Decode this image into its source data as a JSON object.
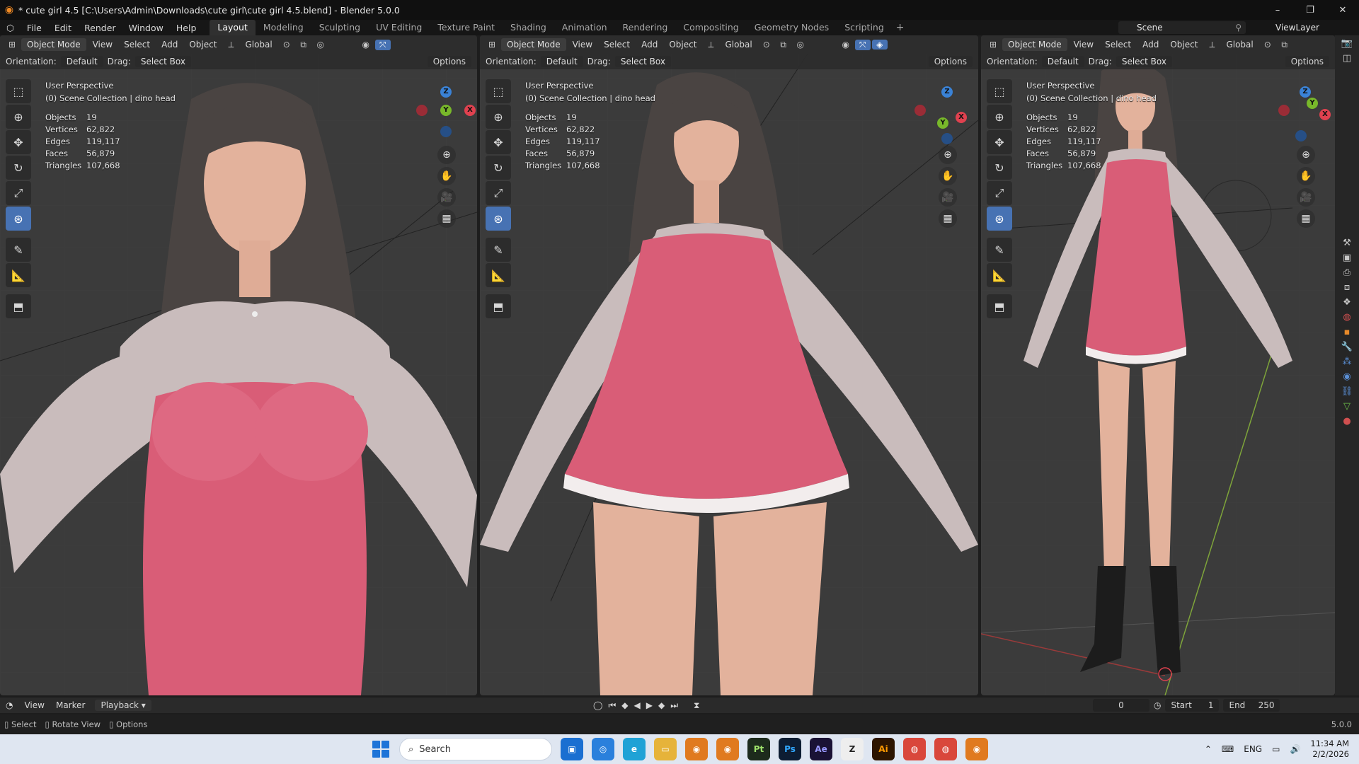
{
  "window": {
    "title": "* cute girl 4.5 [C:\\Users\\Admin\\Downloads\\cute girl\\cute girl 4.5.blend] - Blender 5.0.0",
    "controls": [
      "–",
      "❐",
      "✕"
    ]
  },
  "menubar": {
    "items": [
      "File",
      "Edit",
      "Render",
      "Window",
      "Help"
    ],
    "workspaces": [
      "Layout",
      "Modeling",
      "Sculpting",
      "UV Editing",
      "Texture Paint",
      "Shading",
      "Animation",
      "Rendering",
      "Compositing",
      "Geometry Nodes",
      "Scripting"
    ],
    "active_workspace": "Layout",
    "scene": "Scene",
    "view_layer": "ViewLayer"
  },
  "viewport_header": {
    "mode": "Object Mode",
    "menus": [
      "View",
      "Select",
      "Add",
      "Object"
    ],
    "transform": "Global",
    "orientation_label": "Orientation:",
    "orientation_value": "Default",
    "drag_label": "Drag:",
    "drag_value": "Select Box",
    "options": "Options"
  },
  "viewport_info": {
    "view_name": "User Perspective",
    "collection": "(0) Scene Collection | dino head",
    "stats": [
      {
        "label": "Objects",
        "value": "19"
      },
      {
        "label": "Vertices",
        "value": "62,822"
      },
      {
        "label": "Edges",
        "value": "119,117"
      },
      {
        "label": "Faces",
        "value": "56,879"
      },
      {
        "label": "Triangles",
        "value": "107,668"
      }
    ]
  },
  "gizmo": {
    "x": "X",
    "y": "Y",
    "z": "Z"
  },
  "colors": {
    "accent": "#4772b3",
    "dress": "#d95d77",
    "sleeve": "#c9bcbc",
    "skin": "#e3b29c",
    "hair": "#4a4442",
    "axis_x": "#e0414f",
    "axis_y": "#78b82a",
    "axis_z": "#3a82d6"
  },
  "timeline": {
    "menus": [
      "View",
      "Marker"
    ],
    "playback": "Playback ▾",
    "current_frame": "0",
    "start_label": "Start",
    "start_value": "1",
    "end_label": "End",
    "end_value": "250"
  },
  "statusbar": {
    "hints": [
      "Select",
      "Rotate View",
      "Options"
    ],
    "version": "5.0.0"
  },
  "taskbar": {
    "search": "Search",
    "apps": [
      "Pt",
      "Ps",
      "Ae",
      "Ai"
    ],
    "language": "ENG",
    "time": "11:34 AM",
    "date": "2/2/2026"
  }
}
